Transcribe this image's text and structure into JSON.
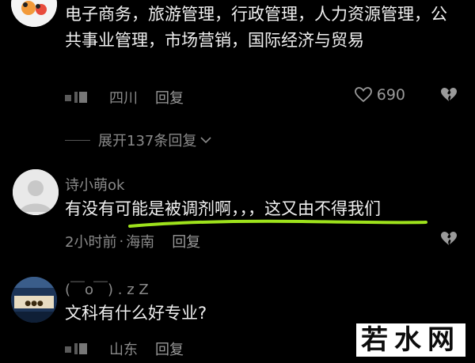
{
  "comments": [
    {
      "text": "电子商务，旅游管理，行政管理，人力资源管理，公共事业管理，市场营销，国际经济与贸易",
      "location": "四川",
      "reply_label": "回复",
      "likes": "690"
    },
    {
      "username": "诗小萌ok",
      "text": "有没有可能是被调剂啊，，，这又由不得我们",
      "time": "2小时前",
      "separator": "·",
      "location": "海南",
      "reply_label": "回复"
    },
    {
      "username": "(￣o￣) . z Z",
      "text": "文科有什么好专业?",
      "location": "山东",
      "reply_label": "回复"
    }
  ],
  "expand_replies": "展开137条回复",
  "watermark": "若水网",
  "colors": {
    "background": "#000000",
    "highlight_underline": "#9ee21c",
    "meta_text": "#8a8a8a"
  }
}
